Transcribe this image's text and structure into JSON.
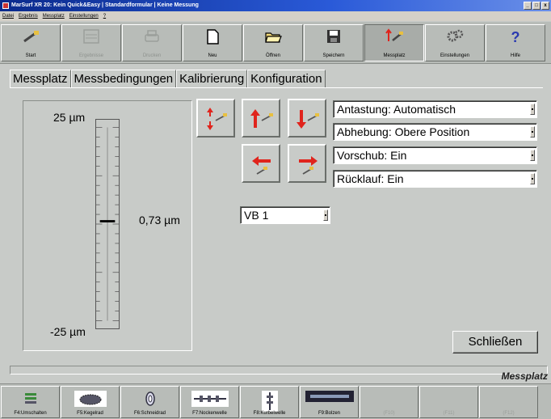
{
  "window": {
    "title": "MarSurf XR 20: Kein Quick&Easy | Standardformular | Keine Messung",
    "controls": [
      "_",
      "□",
      "x"
    ]
  },
  "menu": [
    "Datei",
    "Ergebnis",
    "Messplatz",
    "Einstellungen",
    "?"
  ],
  "toolbar": [
    {
      "label": "Start",
      "icon": "start-icon",
      "disabled": false
    },
    {
      "label": "Ergebnisse",
      "icon": "results-icon",
      "disabled": true
    },
    {
      "label": "Drucken",
      "icon": "printer-icon",
      "disabled": true
    },
    {
      "label": "Neu",
      "icon": "new-document-icon",
      "disabled": false
    },
    {
      "label": "Öffnen",
      "icon": "folder-open-icon",
      "disabled": false
    },
    {
      "label": "Speichern",
      "icon": "save-disk-icon",
      "disabled": false
    },
    {
      "label": "Messplatz",
      "icon": "probe-icon",
      "disabled": false,
      "active": true
    },
    {
      "label": "Einstellungen",
      "icon": "settings-icon",
      "disabled": false
    },
    {
      "label": "Hilfe",
      "icon": "help-icon",
      "disabled": false
    }
  ],
  "tabs": [
    "Messplatz",
    "Messbedingungen",
    "Kalibrierung",
    "Konfiguration"
  ],
  "gauge": {
    "top_label": "25 µm",
    "bottom_label": "-25 µm",
    "value_label": "0,73 µm",
    "min": -25,
    "max": 25,
    "value": 0.73
  },
  "dropdowns": {
    "antastung": "Antastung: Automatisch",
    "abhebung": "Abhebung: Obere Position",
    "vorschub": "Vorschub: Ein",
    "ruecklauf": "Rücklauf: Ein",
    "vb": "VB 1"
  },
  "close_button": "Schließen",
  "status": {
    "mode": "Messplatz"
  },
  "fkeys": [
    {
      "label": "F4:Umschalten",
      "icon": "switch-icon",
      "disabled": false
    },
    {
      "label": "F5:Kegelrad",
      "icon": "bevel-gear-icon",
      "disabled": false
    },
    {
      "label": "F6:Schneidrad",
      "icon": "cutting-wheel-icon",
      "disabled": false
    },
    {
      "label": "F7:Nockenwelle",
      "icon": "camshaft-icon",
      "disabled": false
    },
    {
      "label": "F8:Kurbelwelle",
      "icon": "crankshaft-icon",
      "disabled": false
    },
    {
      "label": "F9:Bolzen",
      "icon": "bolt-icon",
      "disabled": false
    },
    {
      "label": "(F10)",
      "icon": "",
      "disabled": true
    },
    {
      "label": "(F11)",
      "icon": "",
      "disabled": true
    },
    {
      "label": "(F12)",
      "icon": "",
      "disabled": true
    }
  ],
  "colors": {
    "accent_red": "#e0241c",
    "titlebar_blue": "#0a2a8c",
    "background": "#c8cbc8"
  }
}
